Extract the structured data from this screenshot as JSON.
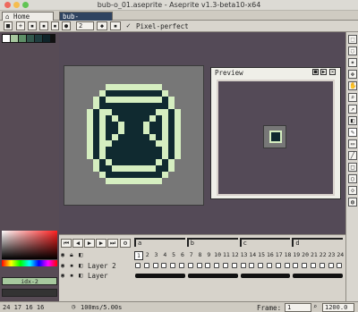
{
  "window": {
    "title": "bub-o_01.aseprite - Aseprite v1.3-beta10-x64"
  },
  "tabs": {
    "home": "Home",
    "file": "bub-o_01.asepr"
  },
  "toolbar": {
    "brush_size": "2",
    "pixel_perfect": "Pixel-perfect"
  },
  "preview": {
    "title": "Preview"
  },
  "palette": {
    "fg_color_label": "idx-2"
  },
  "timeline": {
    "tags": [
      "a",
      "b",
      "c",
      "d"
    ],
    "frame_numbers": [
      "1",
      "2",
      "3",
      "4",
      "5",
      "6",
      "7",
      "8",
      "9",
      "10",
      "11",
      "12",
      "13",
      "14",
      "15",
      "16",
      "17",
      "18",
      "19",
      "20",
      "21",
      "22",
      "23",
      "24"
    ],
    "layers": [
      "Layer 2",
      "Layer"
    ]
  },
  "status": {
    "left": "24 17  16 16",
    "time": "100ms/5.00s",
    "frame_label": "Frame:",
    "frame_value": "1",
    "zoom": "1200.0"
  },
  "colors": {
    "sprite_dark": "#102a30",
    "sprite_light": "#d5eec0",
    "canvas_bg": "#544a57"
  }
}
